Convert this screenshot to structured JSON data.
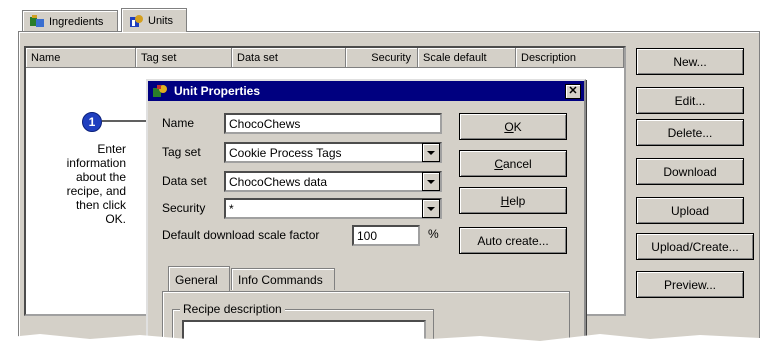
{
  "tabs": [
    {
      "label": "Ingredients",
      "icon": "ingredients-icon"
    },
    {
      "label": "Units",
      "icon": "units-icon"
    }
  ],
  "list": {
    "columns": [
      "Name",
      "Tag set",
      "Data set",
      "Security",
      "Scale default",
      "Description"
    ]
  },
  "side_buttons": [
    "New...",
    "Edit...",
    "Delete...",
    "Download",
    "Upload",
    "Upload/Create...",
    "Preview..."
  ],
  "callout": {
    "number": "1",
    "text_lines": [
      "Enter",
      "information",
      "about the",
      "recipe, and",
      "then click",
      "OK."
    ]
  },
  "dialog": {
    "title": "Unit Properties",
    "close_glyph": "✕",
    "name_label": "Name",
    "name_value": "ChocoChews",
    "tagset_label": "Tag set",
    "tagset_value": "Cookie Process Tags",
    "dataset_label": "Data set",
    "dataset_value": "ChocoChews data",
    "security_label": "Security",
    "security_value": "*",
    "scale_label": "Default download scale factor",
    "scale_value": "100",
    "scale_unit": "%",
    "buttons": {
      "ok_mnemonic": "O",
      "ok_rest": "K",
      "cancel_mnemonic": "C",
      "cancel_rest": "ancel",
      "help_mnemonic": "H",
      "help_rest": "elp",
      "auto_create": "Auto create..."
    },
    "subtabs": [
      "General",
      "Info Commands"
    ],
    "group_label": "Recipe description"
  }
}
